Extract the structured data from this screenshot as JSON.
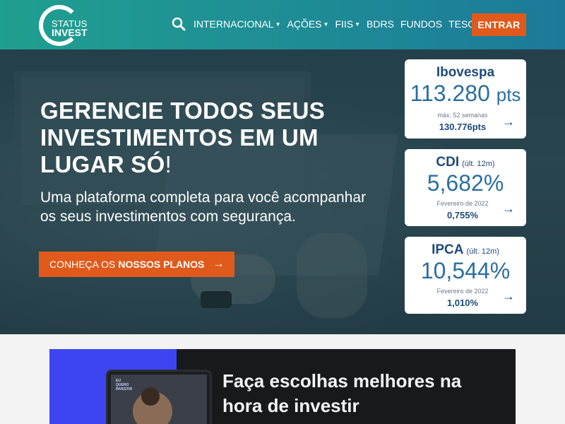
{
  "header": {
    "logo_line1": "STATUS",
    "logo_line2": "INVEST",
    "nav": [
      {
        "label": "INTERNACIONAL",
        "dropdown": true
      },
      {
        "label": "AÇÕES",
        "dropdown": true
      },
      {
        "label": "FIIS",
        "dropdown": true
      },
      {
        "label": "BDRS",
        "dropdown": false
      },
      {
        "label": "FUNDOS",
        "dropdown": false
      },
      {
        "label": "TESOURO",
        "dropdown": false
      }
    ],
    "login_label": "ENTRAR",
    "icons": {
      "search": "search-icon",
      "caret": "chevron-down-icon"
    }
  },
  "hero": {
    "title_line1": "GERENCIE TODOS SEUS",
    "title_line2": "INVESTIMENTOS EM UM",
    "title_line3": "LUGAR SÓ",
    "title_excl": "!",
    "subtitle": "Uma plataforma completa para você acompanhar os seus investimentos com segurança.",
    "cta_prefix": "CONHEÇA OS",
    "cta_strong": "NOSSOS PLANOS",
    "cta_arrow": "→"
  },
  "cards": [
    {
      "title": "Ibovespa",
      "qualifier": "",
      "value": "113.280",
      "unit": "pts",
      "note": "máx. 52 semanas",
      "sub": "130.776pts"
    },
    {
      "title": "CDI",
      "qualifier": "(últ. 12m)",
      "value": "5,682%",
      "unit": "",
      "note": "Fevereiro de 2022",
      "sub": "0,755%"
    },
    {
      "title": "IPCA",
      "qualifier": "(últ. 12m)",
      "value": "10,544%",
      "unit": "",
      "note": "Fevereiro de 2022",
      "sub": "1,010%"
    }
  ],
  "card_arrow": "→",
  "banner": {
    "text_line1": "Faça escolhas melhores na",
    "text_line2": "hora de investir",
    "tablet_text_1": "EU",
    "tablet_text_2": "QUERO",
    "tablet_text_3": "INVESTIR"
  },
  "colors": {
    "header_start": "#1f9f8f",
    "header_end": "#1c7a99",
    "accent": "#e05a1b",
    "card_title": "#1d4a7a",
    "card_value": "#2a6fa0",
    "banner_blue": "#3d45f2"
  }
}
